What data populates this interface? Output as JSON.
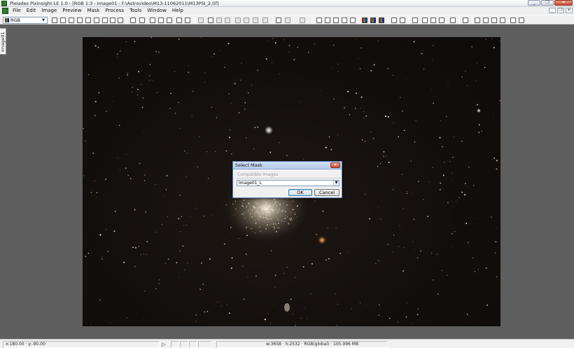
{
  "window": {
    "title": "Pleiades PixInsight LE 1.0 - [RGB 1:3 - Image01 - F:\\Astrovideo\\M13-11062011\\M13PSI_2.tif]",
    "buttons": [
      "_",
      "❐",
      "✕"
    ]
  },
  "menu": {
    "items": [
      "File",
      "Edit",
      "Image",
      "Preview",
      "Mask",
      "Process",
      "Tools",
      "Window",
      "Help"
    ],
    "doc_buttons": [
      "_",
      "❐",
      "✕"
    ]
  },
  "toolbar": {
    "color_mode": "RGB"
  },
  "side_tab": {
    "label": "Image01"
  },
  "dialog": {
    "title": "Select Mask",
    "close": "✕",
    "group_label": "Compatible Images",
    "selected_image": "Image01_L",
    "ok_label": "OK",
    "cancel_label": "Cancel"
  },
  "status": {
    "coords": "x:180.00 · y:-90.00",
    "play": "▷",
    "image_info": "w:3658 · h:2532 · RGB(global) · 105.996 MB"
  }
}
